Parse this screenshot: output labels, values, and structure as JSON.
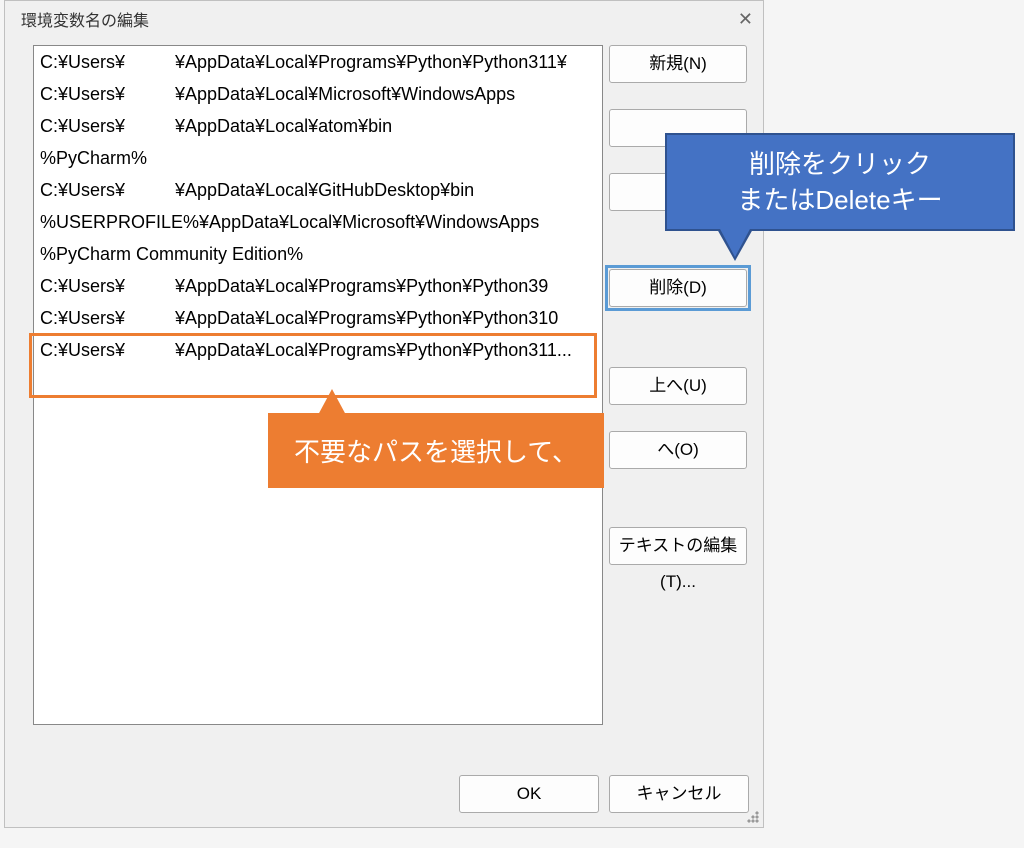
{
  "dialog": {
    "title": "環境変数名の編集"
  },
  "paths": [
    {
      "col1": "C:¥Users¥",
      "col2": "¥AppData¥Local¥Programs¥Python¥Python311¥"
    },
    {
      "col1": "C:¥Users¥",
      "col2": "¥AppData¥Local¥Microsoft¥WindowsApps"
    },
    {
      "col1": "C:¥Users¥",
      "col2": "¥AppData¥Local¥atom¥bin"
    },
    {
      "col1": "%PyCharm%",
      "col2": ""
    },
    {
      "col1": "C:¥Users¥",
      "col2": "¥AppData¥Local¥GitHubDesktop¥bin"
    },
    {
      "col1": "%USERPROFILE%¥AppData¥Local¥Microsoft¥WindowsApps",
      "col2": ""
    },
    {
      "col1": "%PyCharm Community Edition%",
      "col2": ""
    },
    {
      "col1": "C:¥Users¥",
      "col2": "¥AppData¥Local¥Programs¥Python¥Python39"
    },
    {
      "col1": "C:¥Users¥",
      "col2": "¥AppData¥Local¥Programs¥Python¥Python310"
    },
    {
      "col1": "C:¥Users¥",
      "col2": "¥AppData¥Local¥Programs¥Python¥Python311..."
    }
  ],
  "buttons": {
    "new": "新規(N)",
    "edit": "",
    "browse": "",
    "delete": "削除(D)",
    "up": "上へ(U)",
    "down": "へ(O)",
    "text": "テキストの編集(T)...",
    "ok": "OK",
    "cancel": "キャンセル"
  },
  "annotations": {
    "orange": "不要なパスを選択して、",
    "blue_line1": "削除をクリック",
    "blue_line2": "またはDeleteキー"
  }
}
